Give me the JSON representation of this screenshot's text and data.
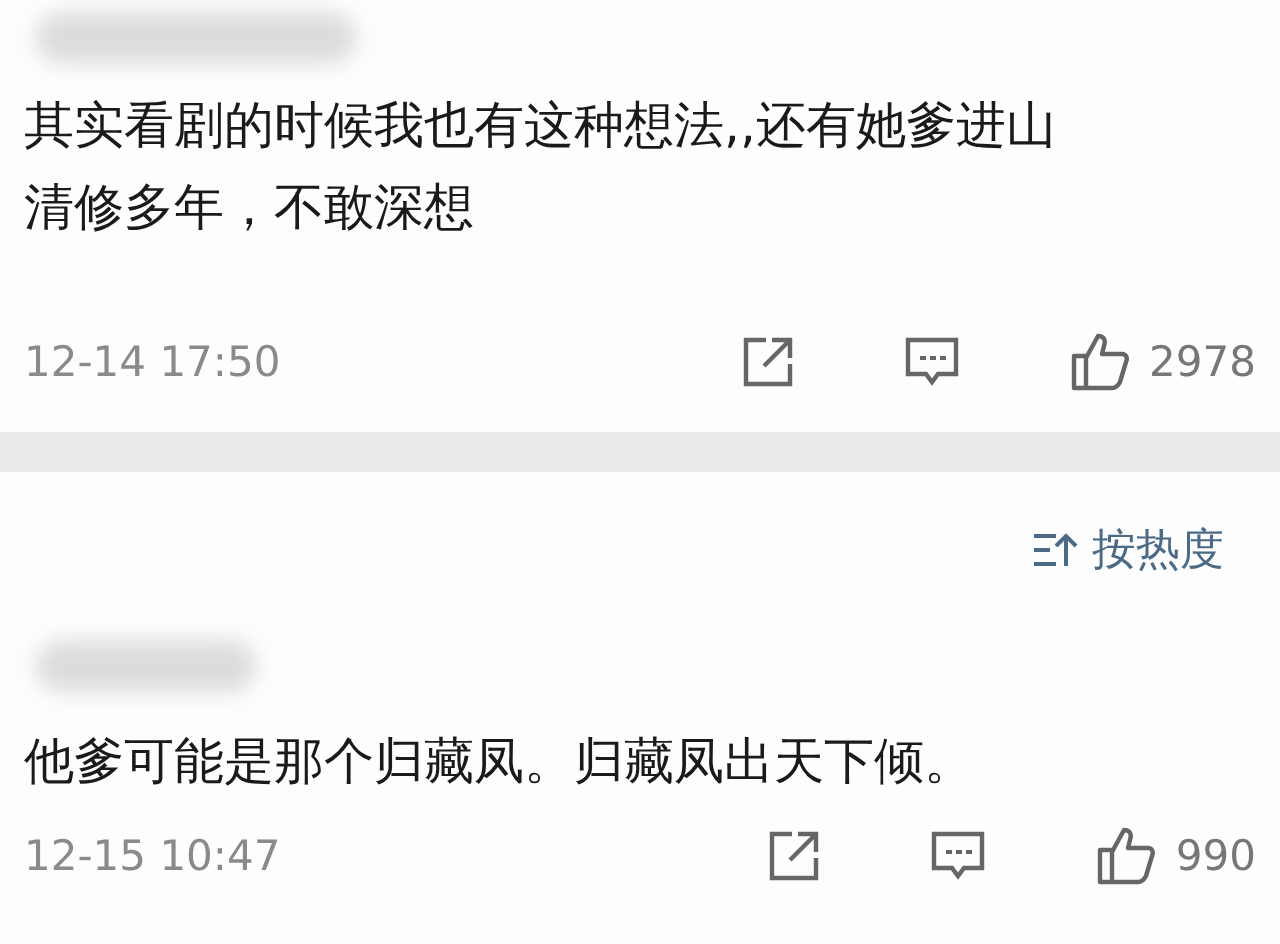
{
  "comments": [
    {
      "text": "其实看剧的时候我也有这种想法,,还有她爹进山清修多年，不敢深想",
      "time": "12-14 17:50",
      "likes": "2978"
    },
    {
      "text": "他爹可能是那个归藏凤。归藏凤出天下倾。",
      "time": "12-15 10:47",
      "likes": "990"
    }
  ],
  "sort": {
    "label": "按热度"
  }
}
